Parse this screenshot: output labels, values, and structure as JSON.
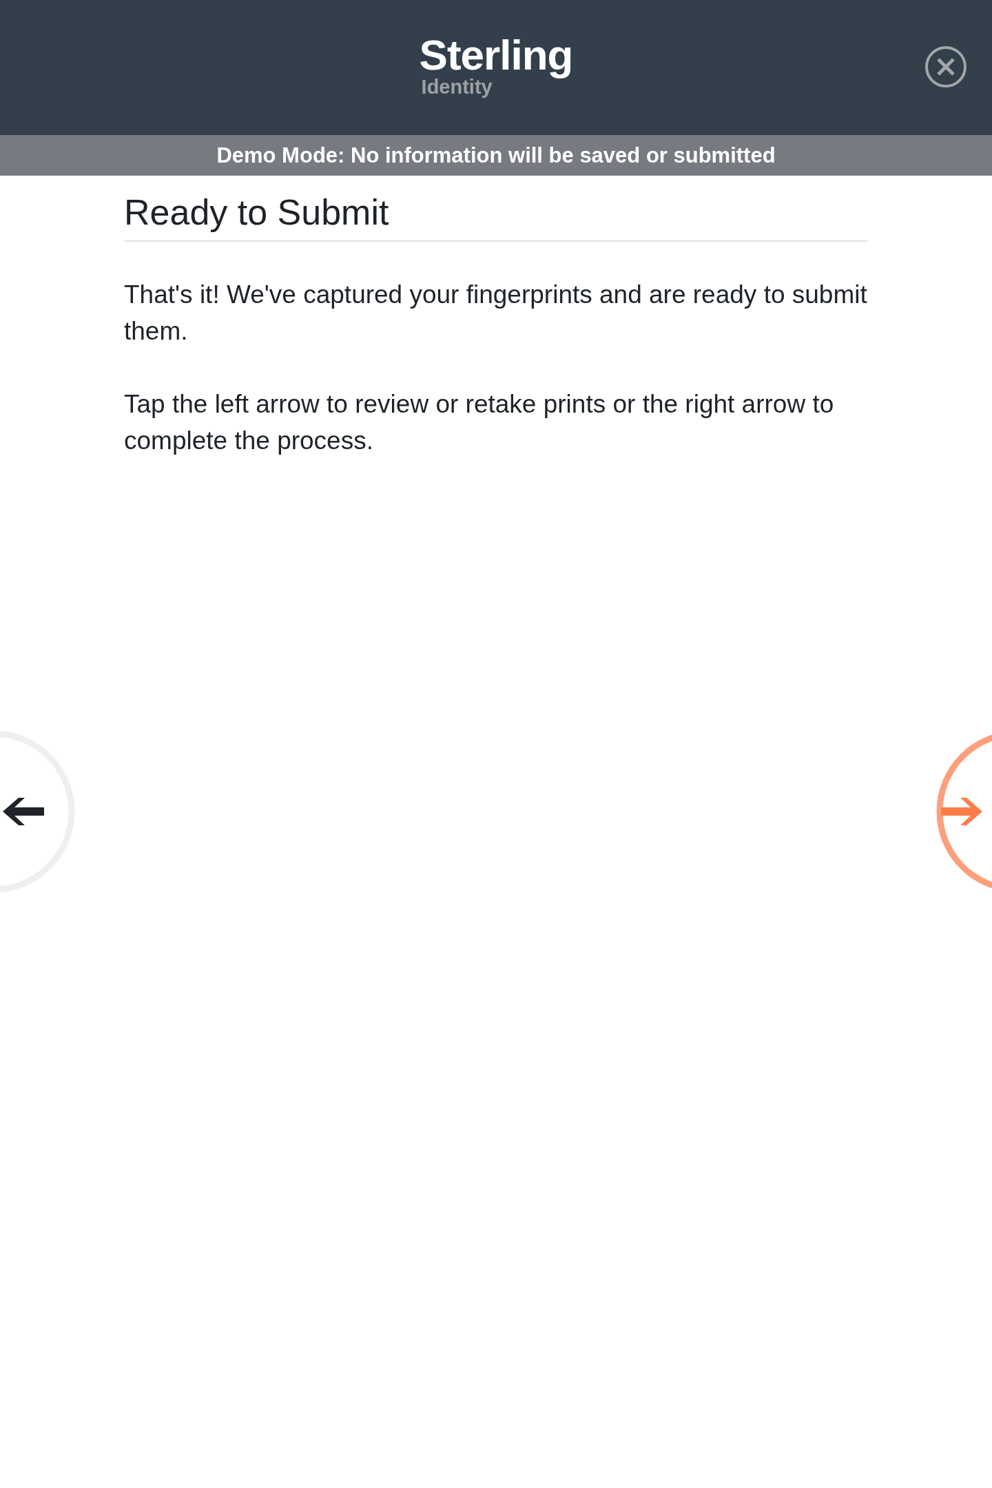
{
  "header": {
    "logo_name": "Sterling",
    "logo_tagline": "Identity"
  },
  "demo_banner": "Demo Mode: No information will be saved or submitted",
  "title": "Ready to Submit",
  "paragraphs": [
    "That's it! We've captured your fingerprints and are ready to submit them.",
    "Tap the left arrow to review or retake prints or the right arrow to complete the process."
  ]
}
